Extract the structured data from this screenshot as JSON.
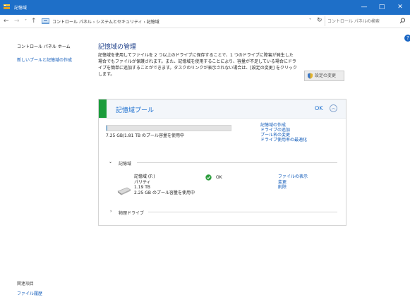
{
  "window": {
    "title": "記憶域",
    "minimize": "—",
    "maximize": "□",
    "close": "✕"
  },
  "address": {
    "back": "←",
    "forward": "→",
    "recent": "˅",
    "up": "↑",
    "path": "コントロール パネル › システムとセキュリティ › 記憶域",
    "path_prefix": "›",
    "dropdown": "˅",
    "refresh": "↻",
    "search_placeholder": "コントロール パネルの検索"
  },
  "sidebar": {
    "home": "コントロール パネル ホーム",
    "create_pool": "新しいプールと記憶域の作成",
    "see_also": "関連項目",
    "file_history": "ファイル履歴"
  },
  "main": {
    "help": "?",
    "title": "記憶域の管理",
    "description": "記憶域を使用してファイルを 2 つ以上のドライブに保存することで、1 つのドライブに障害が発生した場合でもファイルが保護されます。また、記憶域を使用することにより、容量が不足している場合にドライブを簡単に追加することができます。タスクのリンクが表示されない場合は、[設定の変更] をクリックします。",
    "change_settings": "設定の変更"
  },
  "pool": {
    "title": "記憶域プール",
    "status": "OK",
    "collapse": "︿",
    "usage_fraction": 0.004,
    "usage_text": "7.25 GB/1.81 TB のプール容量を使用中",
    "links": [
      "記憶域の作成",
      "ドライブの追加",
      "プール名の変更",
      "ドライブ使用率の最適化"
    ],
    "spaces_section": "記憶域",
    "spaces_chevron": "⌄",
    "drive_name": "記憶域 (F:)",
    "drive_type": "パリティ",
    "drive_size": "1.19 TB",
    "drive_usage": "2.25 GB のプール容量を使用中",
    "drive_status": "OK",
    "drive_links": [
      "ファイルの表示",
      "変更",
      "削除"
    ],
    "physical_section": "物理ドライブ",
    "physical_chevron": "›"
  },
  "colors": {
    "titlebar": "#1e6fc8",
    "pool_accent": "#1a9c3b",
    "link": "#0b57b8",
    "usage_fill": "#2a8bd7",
    "status_ok": "#2e9e3e"
  }
}
